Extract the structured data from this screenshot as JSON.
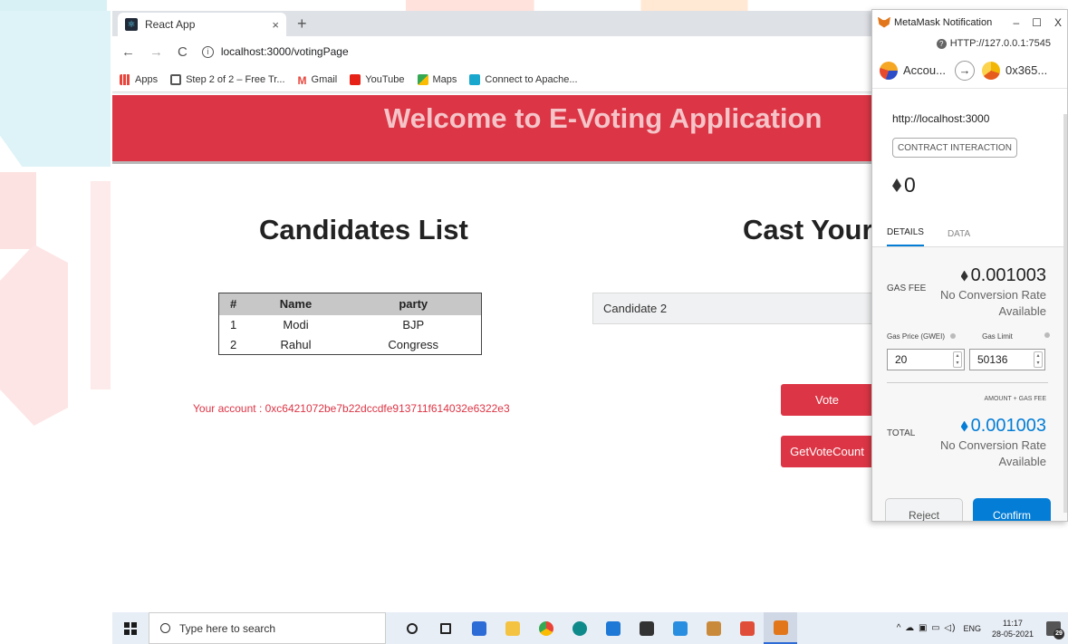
{
  "browser": {
    "tab_title": "React App",
    "tab_close": "×",
    "new_tab": "+",
    "url": "localhost:3000/votingPage",
    "back": "←",
    "forward": "→",
    "reload": "C",
    "bookmarks": [
      {
        "label": "Apps",
        "icon": "apps-grid-icon"
      },
      {
        "label": "Step 2 of 2 – Free Tr...",
        "icon": "gear-icon"
      },
      {
        "label": "Gmail",
        "icon": "gmail-icon"
      },
      {
        "label": "YouTube",
        "icon": "youtube-icon"
      },
      {
        "label": "Maps",
        "icon": "maps-icon"
      },
      {
        "label": "Connect to Apache...",
        "icon": "apache-icon"
      }
    ]
  },
  "app": {
    "header_title": "Welcome to E-Voting Application",
    "candidates_heading": "Candidates List",
    "cast_heading": "Cast Your Vote",
    "table": {
      "headers": [
        "#",
        "Name",
        "party"
      ],
      "rows": [
        [
          "1",
          "Modi",
          "BJP"
        ],
        [
          "2",
          "Rahul",
          "Congress"
        ]
      ]
    },
    "account_label": "Your account : 0xc6421072be7b22dccdfe913711f614032e6322e3",
    "selected_candidate": "Candidate 2",
    "vote_button": "Vote",
    "getvotecount_button": "GetVoteCount"
  },
  "metamask": {
    "window_title": "MetaMask Notification",
    "minimize": "–",
    "maximize": "☐",
    "close": "X",
    "rpc_url": "HTTP://127.0.0.1:7545",
    "from_account": "Accou...",
    "to_account": "0x365...",
    "origin": "http://localhost:3000",
    "badge": "CONTRACT INTERACTION",
    "amount": "0",
    "tabs": [
      "DETAILS",
      "DATA"
    ],
    "gas_fee_label": "GAS FEE",
    "gas_fee_value": "0.001003",
    "gas_fee_conversion": "No Conversion Rate Available",
    "gas_price_label": "Gas Price (GWEI)",
    "gas_limit_label": "Gas Limit",
    "gas_price_value": "20",
    "gas_limit_value": "50136",
    "amount_gas_label": "AMOUNT + GAS FEE",
    "total_label": "TOTAL",
    "total_value": "0.001003",
    "total_conversion": "No Conversion Rate Available",
    "reject_button": "Reject",
    "confirm_button": "Confirm"
  },
  "taskbar": {
    "search_placeholder": "Type here to search",
    "language": "ENG",
    "time": "11:17",
    "date": "28-05-2021",
    "notification_count": "29"
  }
}
